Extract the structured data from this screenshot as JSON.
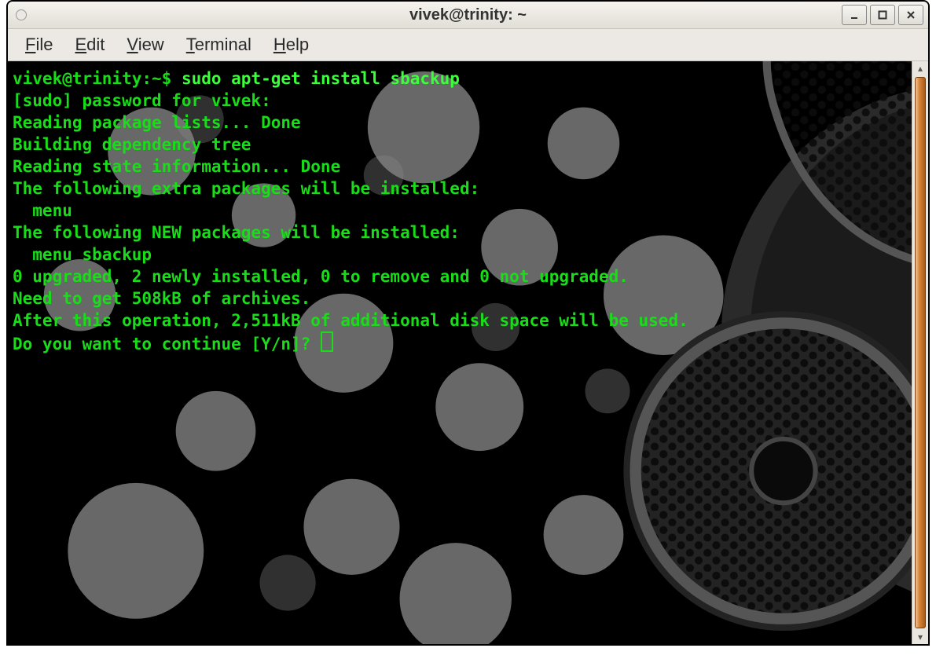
{
  "window": {
    "title": "vivek@trinity: ~"
  },
  "menubar": {
    "file": "File",
    "edit": "Edit",
    "view": "View",
    "terminal": "Terminal",
    "help": "Help"
  },
  "prompt": {
    "user_host_path": "vivek@trinity:~$ ",
    "command": "sudo apt-get install sbackup"
  },
  "output_lines": [
    "[sudo] password for vivek:",
    "Reading package lists... Done",
    "Building dependency tree",
    "Reading state information... Done",
    "The following extra packages will be installed:",
    "  menu",
    "The following NEW packages will be installed:",
    "  menu sbackup",
    "0 upgraded, 2 newly installed, 0 to remove and 0 not upgraded.",
    "Need to get 508kB of archives.",
    "After this operation, 2,511kB of additional disk space will be used.",
    "Do you want to continue [Y/n]? "
  ]
}
